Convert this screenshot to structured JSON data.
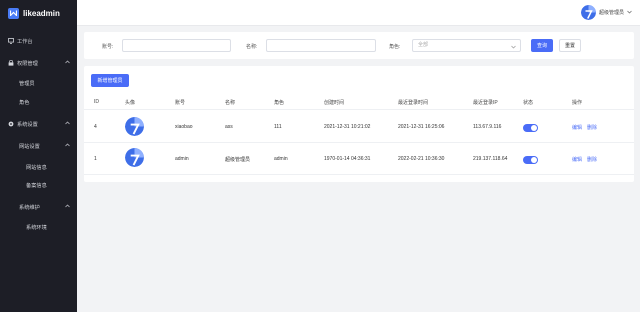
{
  "app": {
    "name": "likeadmin"
  },
  "sidebar": {
    "items": [
      {
        "label": "工作台",
        "icon": "monitor-icon"
      },
      {
        "label": "权限管理",
        "icon": "lock-icon"
      },
      {
        "label": "管理员"
      },
      {
        "label": "角色"
      },
      {
        "label": "系统设置",
        "icon": "gear-icon"
      },
      {
        "label": "网站设置"
      },
      {
        "label": "网站信息"
      },
      {
        "label": "备案信息"
      },
      {
        "label": "系统维护"
      },
      {
        "label": "系统环境"
      }
    ]
  },
  "header": {
    "username": "超级管理员"
  },
  "search": {
    "account_label": "账号:",
    "name_label": "名称:",
    "role_label": "角色:",
    "role_value": "全部",
    "query_btn": "查询",
    "reset_btn": "重置"
  },
  "table": {
    "add_btn": "新增管理员",
    "columns": [
      "ID",
      "头像",
      "账号",
      "名称",
      "角色",
      "创建时间",
      "最近登录时间",
      "最近登录IP",
      "状态",
      "操作"
    ],
    "rows": [
      {
        "id": "4",
        "account": "xiaobao",
        "name": "ass",
        "role": "111",
        "created": "2021-12-31 10:21:02",
        "last_login": "2021-12-31 16:25:06",
        "ip": "113.67.9.116",
        "status": "on",
        "edit": "编辑",
        "delete": "删除"
      },
      {
        "id": "1",
        "account": "admin",
        "name": "超级管理员",
        "role": "admin",
        "created": "1970-01-14 04:36:31",
        "last_login": "2022-02-21 10:36:30",
        "ip": "219.137.118.64",
        "status": "on",
        "edit": "编辑",
        "delete": "删除"
      }
    ]
  },
  "colors": {
    "primary": "#4a6cf7",
    "sidebar_bg": "#1d1e26"
  }
}
